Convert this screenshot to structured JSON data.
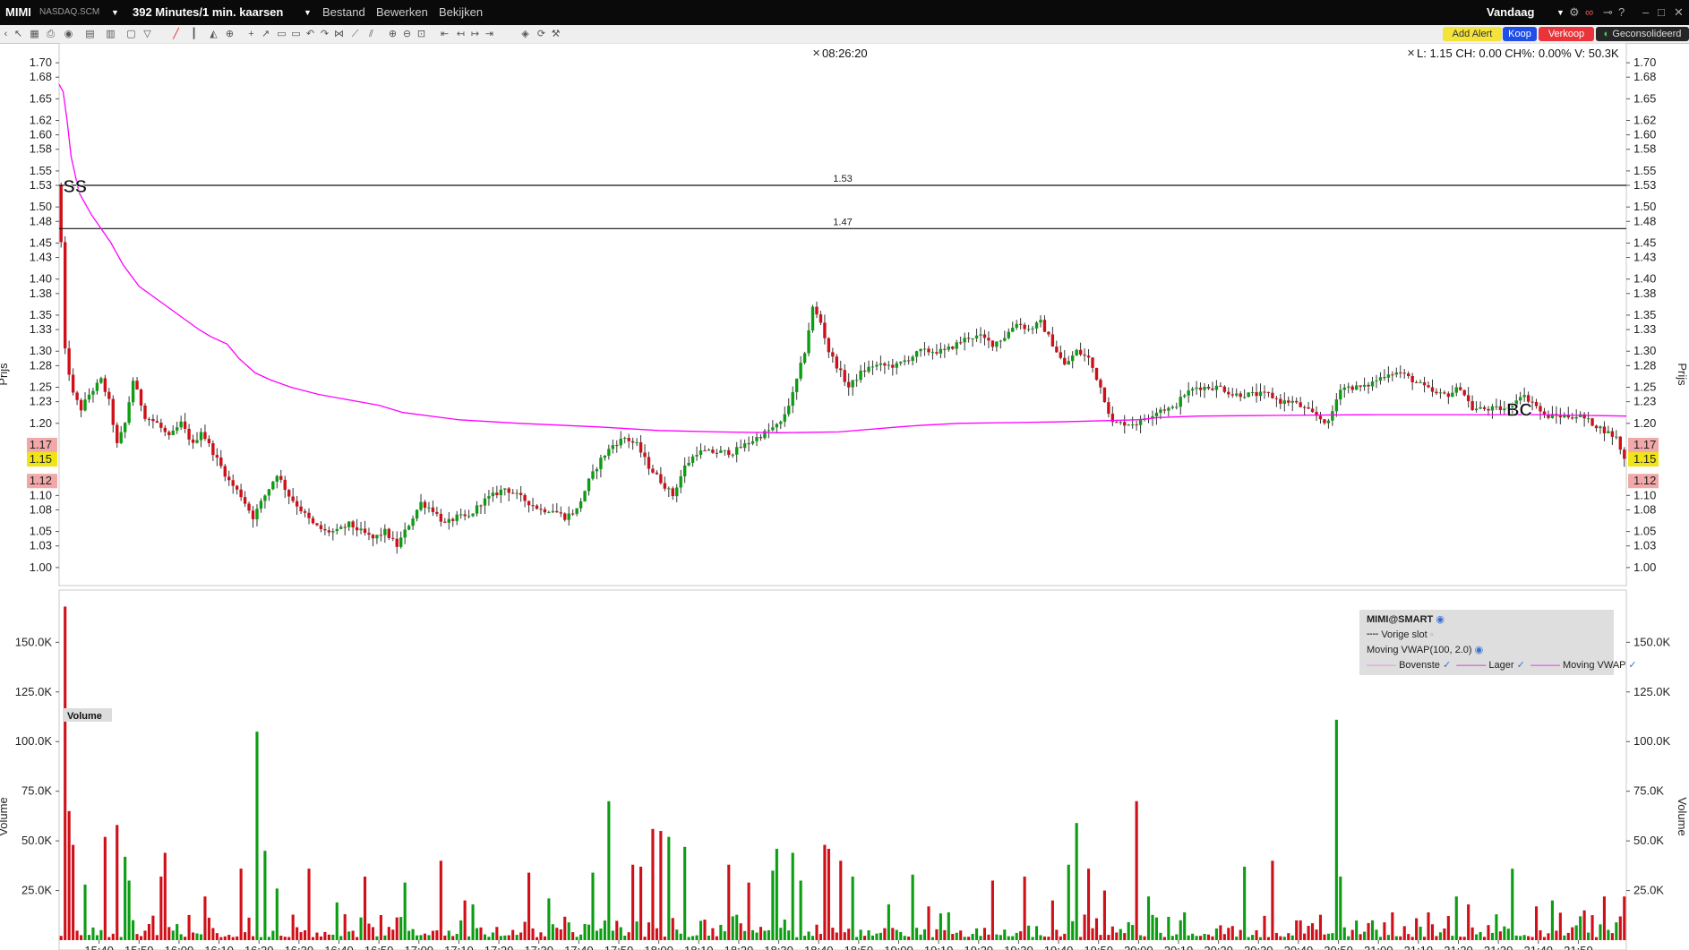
{
  "window": {
    "ticker": "MIMI",
    "exchange": "NASDAQ.SCM",
    "interval_label": "392 Minutes/1 min. kaarsen",
    "menus": [
      "Bestand",
      "Bewerken",
      "Bekijken"
    ],
    "period_label": "Vandaag"
  },
  "buttons": {
    "alert": "Add Alert",
    "buy": "Koop",
    "sell": "Verkoop",
    "consolidated": "Geconsolideerd"
  },
  "chart_info": {
    "crosshair_time": "08:26:20",
    "quote_line": "L: 1.15 CH: 0.00 CH%: 0.00% V: 50.3K"
  },
  "colors": {
    "up": "#0c9d13",
    "down": "#cf1019",
    "vwap": "#ff00ff",
    "band": "#ee77ee",
    "last_price_bg": "#f0e316",
    "hl_bg": "#f1a8a8"
  },
  "chart_data": {
    "type": "candlestick",
    "price_axis_label": "Prijs",
    "volume_axis_label": "Volume",
    "volume_panel_title": "Volume",
    "price_ticks": [
      1.0,
      1.03,
      1.05,
      1.08,
      1.1,
      1.12,
      1.15,
      1.17,
      1.2,
      1.23,
      1.25,
      1.28,
      1.3,
      1.33,
      1.35,
      1.38,
      1.4,
      1.43,
      1.45,
      1.48,
      1.5,
      1.53,
      1.55,
      1.58,
      1.6,
      1.62,
      1.65,
      1.68,
      1.7
    ],
    "price_range": [
      0.975,
      1.715
    ],
    "volume_ticks": [
      "25.0K",
      "50.0K",
      "75.0K",
      "100.0K",
      "125.0K",
      "150.0K"
    ],
    "volume_tick_values": [
      25000,
      50000,
      75000,
      100000,
      125000,
      150000
    ],
    "volume_range": [
      0,
      170000
    ],
    "time_ticks": [
      "15:40",
      "15:50",
      "16:00",
      "16:10",
      "16:20",
      "16:30",
      "16:40",
      "16:50",
      "17:00",
      "17:10",
      "17:20",
      "17:30",
      "17:40",
      "17:50",
      "18:00",
      "18:10",
      "18:20",
      "18:30",
      "18:40",
      "18:50",
      "19:00",
      "19:10",
      "19:20",
      "19:30",
      "19:40",
      "19:50",
      "20:00",
      "20:10",
      "20:20",
      "20:30",
      "20:40",
      "20:50",
      "21:00",
      "21:10",
      "21:20",
      "21:30",
      "21:40",
      "21:50"
    ],
    "x_range_minutes": [
      930,
      1322
    ],
    "hlines": [
      {
        "value": 1.53,
        "label": "1.53"
      },
      {
        "value": 1.47,
        "label": "1.47"
      }
    ],
    "highlight_labels": [
      {
        "value": 1.17,
        "label": "1.17",
        "kind": "high"
      },
      {
        "value": 1.15,
        "label": "1.15",
        "kind": "last"
      },
      {
        "value": 1.12,
        "label": "1.12",
        "kind": "low"
      }
    ],
    "markers": [
      {
        "t": 931,
        "price": 1.53,
        "text": "SS"
      },
      {
        "t": 1292,
        "price": 1.22,
        "text": "BC"
      }
    ],
    "vwap": [
      [
        930,
        1.67
      ],
      [
        931,
        1.66
      ],
      [
        932,
        1.62
      ],
      [
        933,
        1.57
      ],
      [
        935,
        1.52
      ],
      [
        938,
        1.49
      ],
      [
        943,
        1.45
      ],
      [
        946,
        1.42
      ],
      [
        950,
        1.39
      ],
      [
        955,
        1.37
      ],
      [
        960,
        1.35
      ],
      [
        965,
        1.33
      ],
      [
        968,
        1.32
      ],
      [
        972,
        1.31
      ],
      [
        975,
        1.29
      ],
      [
        979,
        1.27
      ],
      [
        983,
        1.26
      ],
      [
        988,
        1.25
      ],
      [
        995,
        1.24
      ],
      [
        1005,
        1.23
      ],
      [
        1010,
        1.225
      ],
      [
        1016,
        1.215
      ],
      [
        1030,
        1.205
      ],
      [
        1045,
        1.2
      ],
      [
        1065,
        1.195
      ],
      [
        1080,
        1.19
      ],
      [
        1095,
        1.188
      ],
      [
        1110,
        1.187
      ],
      [
        1125,
        1.188
      ],
      [
        1140,
        1.195
      ],
      [
        1145,
        1.197
      ],
      [
        1155,
        1.2
      ],
      [
        1180,
        1.202
      ],
      [
        1200,
        1.205
      ],
      [
        1205,
        1.208
      ],
      [
        1215,
        1.21
      ],
      [
        1235,
        1.211
      ],
      [
        1260,
        1.212
      ],
      [
        1285,
        1.212
      ],
      [
        1300,
        1.212
      ],
      [
        1322,
        1.21
      ]
    ],
    "price_path": [
      [
        930,
        1.53
      ],
      [
        931,
        1.45
      ],
      [
        932,
        1.3
      ],
      [
        934,
        1.24
      ],
      [
        936,
        1.22
      ],
      [
        938,
        1.24
      ],
      [
        941,
        1.26
      ],
      [
        943,
        1.23
      ],
      [
        945,
        1.17
      ],
      [
        947,
        1.2
      ],
      [
        949,
        1.26
      ],
      [
        952,
        1.21
      ],
      [
        955,
        1.2
      ],
      [
        958,
        1.18
      ],
      [
        961,
        1.2
      ],
      [
        964,
        1.17
      ],
      [
        966,
        1.19
      ],
      [
        969,
        1.16
      ],
      [
        971,
        1.14
      ],
      [
        973,
        1.12
      ],
      [
        976,
        1.1
      ],
      [
        979,
        1.07
      ],
      [
        982,
        1.1
      ],
      [
        985,
        1.13
      ],
      [
        988,
        1.1
      ],
      [
        991,
        1.08
      ],
      [
        994,
        1.06
      ],
      [
        997,
        1.05
      ],
      [
        1000,
        1.05
      ],
      [
        1003,
        1.06
      ],
      [
        1006,
        1.05
      ],
      [
        1009,
        1.04
      ],
      [
        1012,
        1.05
      ],
      [
        1015,
        1.03
      ],
      [
        1018,
        1.06
      ],
      [
        1021,
        1.09
      ],
      [
        1024,
        1.08
      ],
      [
        1027,
        1.06
      ],
      [
        1030,
        1.07
      ],
      [
        1033,
        1.07
      ],
      [
        1036,
        1.09
      ],
      [
        1039,
        1.1
      ],
      [
        1042,
        1.11
      ],
      [
        1045,
        1.1
      ],
      [
        1048,
        1.09
      ],
      [
        1051,
        1.08
      ],
      [
        1054,
        1.08
      ],
      [
        1057,
        1.07
      ],
      [
        1060,
        1.08
      ],
      [
        1063,
        1.12
      ],
      [
        1066,
        1.15
      ],
      [
        1069,
        1.17
      ],
      [
        1072,
        1.18
      ],
      [
        1075,
        1.17
      ],
      [
        1078,
        1.14
      ],
      [
        1081,
        1.12
      ],
      [
        1084,
        1.1
      ],
      [
        1087,
        1.14
      ],
      [
        1090,
        1.16
      ],
      [
        1093,
        1.16
      ],
      [
        1096,
        1.16
      ],
      [
        1099,
        1.16
      ],
      [
        1102,
        1.17
      ],
      [
        1105,
        1.18
      ],
      [
        1108,
        1.19
      ],
      [
        1111,
        1.2
      ],
      [
        1114,
        1.24
      ],
      [
        1117,
        1.3
      ],
      [
        1119,
        1.36
      ],
      [
        1121,
        1.34
      ],
      [
        1123,
        1.3
      ],
      [
        1126,
        1.27
      ],
      [
        1128,
        1.25
      ],
      [
        1131,
        1.27
      ],
      [
        1134,
        1.28
      ],
      [
        1137,
        1.28
      ],
      [
        1140,
        1.28
      ],
      [
        1143,
        1.29
      ],
      [
        1146,
        1.3
      ],
      [
        1149,
        1.3
      ],
      [
        1152,
        1.3
      ],
      [
        1155,
        1.31
      ],
      [
        1158,
        1.32
      ],
      [
        1161,
        1.32
      ],
      [
        1164,
        1.31
      ],
      [
        1167,
        1.32
      ],
      [
        1170,
        1.34
      ],
      [
        1173,
        1.33
      ],
      [
        1176,
        1.34
      ],
      [
        1179,
        1.31
      ],
      [
        1182,
        1.28
      ],
      [
        1185,
        1.3
      ],
      [
        1188,
        1.29
      ],
      [
        1191,
        1.25
      ],
      [
        1194,
        1.2
      ],
      [
        1197,
        1.2
      ],
      [
        1200,
        1.2
      ],
      [
        1203,
        1.21
      ],
      [
        1206,
        1.22
      ],
      [
        1209,
        1.22
      ],
      [
        1212,
        1.24
      ],
      [
        1215,
        1.25
      ],
      [
        1218,
        1.25
      ],
      [
        1221,
        1.25
      ],
      [
        1224,
        1.24
      ],
      [
        1227,
        1.24
      ],
      [
        1230,
        1.24
      ],
      [
        1233,
        1.24
      ],
      [
        1236,
        1.23
      ],
      [
        1239,
        1.23
      ],
      [
        1242,
        1.22
      ],
      [
        1245,
        1.21
      ],
      [
        1248,
        1.2
      ],
      [
        1251,
        1.25
      ],
      [
        1254,
        1.25
      ],
      [
        1257,
        1.25
      ],
      [
        1260,
        1.26
      ],
      [
        1263,
        1.27
      ],
      [
        1266,
        1.27
      ],
      [
        1269,
        1.26
      ],
      [
        1272,
        1.25
      ],
      [
        1275,
        1.24
      ],
      [
        1278,
        1.24
      ],
      [
        1281,
        1.25
      ],
      [
        1284,
        1.22
      ],
      [
        1287,
        1.22
      ],
      [
        1290,
        1.22
      ],
      [
        1293,
        1.22
      ],
      [
        1296,
        1.24
      ],
      [
        1299,
        1.23
      ],
      [
        1302,
        1.21
      ],
      [
        1305,
        1.21
      ],
      [
        1308,
        1.21
      ],
      [
        1311,
        1.21
      ],
      [
        1314,
        1.2
      ],
      [
        1317,
        1.19
      ],
      [
        1320,
        1.18
      ],
      [
        1322,
        1.15
      ]
    ],
    "volume_spikes": [
      [
        931,
        168000
      ],
      [
        932,
        65000
      ],
      [
        933,
        48000
      ],
      [
        936,
        28000
      ],
      [
        941,
        52000
      ],
      [
        944,
        58000
      ],
      [
        946,
        42000
      ],
      [
        947,
        30000
      ],
      [
        955,
        32000
      ],
      [
        956,
        44000
      ],
      [
        966,
        22000
      ],
      [
        975,
        36000
      ],
      [
        979,
        105000
      ],
      [
        981,
        45000
      ],
      [
        984,
        26000
      ],
      [
        992,
        36000
      ],
      [
        999,
        19000
      ],
      [
        1006,
        32000
      ],
      [
        1016,
        29000
      ],
      [
        1025,
        40000
      ],
      [
        1031,
        20000
      ],
      [
        1033,
        18000
      ],
      [
        1047,
        34000
      ],
      [
        1052,
        21000
      ],
      [
        1063,
        34000
      ],
      [
        1067,
        70000
      ],
      [
        1073,
        38000
      ],
      [
        1075,
        37000
      ],
      [
        1078,
        56000
      ],
      [
        1080,
        55000
      ],
      [
        1082,
        52000
      ],
      [
        1086,
        47000
      ],
      [
        1097,
        38000
      ],
      [
        1102,
        29000
      ],
      [
        1108,
        35000
      ],
      [
        1109,
        46000
      ],
      [
        1113,
        44000
      ],
      [
        1115,
        30000
      ],
      [
        1121,
        48000
      ],
      [
        1122,
        46000
      ],
      [
        1125,
        40000
      ],
      [
        1128,
        32000
      ],
      [
        1137,
        18000
      ],
      [
        1143,
        33000
      ],
      [
        1147,
        17000
      ],
      [
        1152,
        14000
      ],
      [
        1163,
        30000
      ],
      [
        1171,
        32000
      ],
      [
        1178,
        20000
      ],
      [
        1182,
        38000
      ],
      [
        1184,
        59000
      ],
      [
        1187,
        36000
      ],
      [
        1191,
        25000
      ],
      [
        1199,
        70000
      ],
      [
        1202,
        22000
      ],
      [
        1210,
        10000
      ],
      [
        1226,
        37000
      ],
      [
        1233,
        40000
      ],
      [
        1249,
        111000
      ],
      [
        1250,
        32000
      ],
      [
        1258,
        10000
      ],
      [
        1263,
        14000
      ],
      [
        1272,
        14000
      ],
      [
        1279,
        22000
      ],
      [
        1282,
        18000
      ],
      [
        1289,
        13000
      ],
      [
        1293,
        36000
      ],
      [
        1299,
        17000
      ],
      [
        1303,
        20000
      ],
      [
        1311,
        15000
      ],
      [
        1316,
        22000
      ],
      [
        1321,
        22000
      ],
      [
        1322,
        5000
      ]
    ],
    "legend": {
      "instrument": "MIMI@SMART",
      "prev_close": "Vorige slot",
      "indicator": "Moving VWAP(100, 2.0)",
      "items": [
        "Bovenste",
        "Lager",
        "Moving VWAP"
      ]
    }
  }
}
